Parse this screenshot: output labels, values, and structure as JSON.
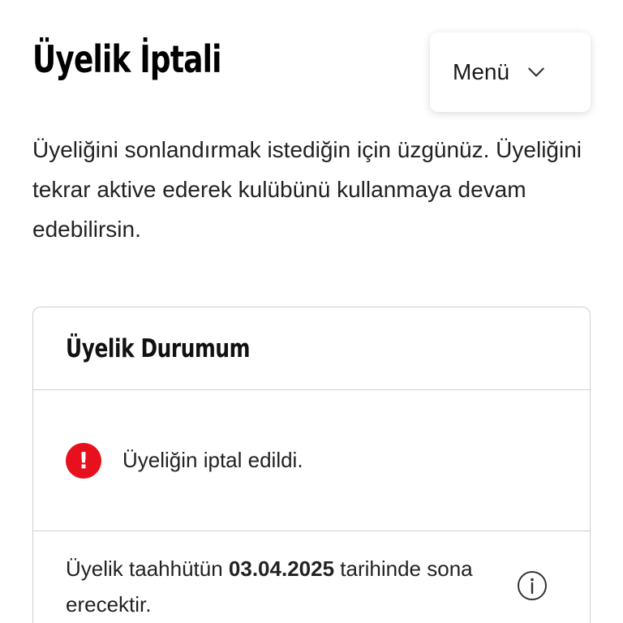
{
  "header": {
    "title": "Üyelik İptali",
    "menu_label": "Menü",
    "menu_icon": "chevron-down-icon"
  },
  "intro": {
    "text": "Üyeliğini sonlandırmak istediğin için üzgünüz. Üyeliğini tekrar aktive ederek kulübünü kullanmaya devam edebilirsin."
  },
  "membership_card": {
    "title": "Üyelik Durumum",
    "status": {
      "icon": "alert-icon",
      "icon_glyph": "!",
      "text": "Üyeliğin iptal edildi."
    },
    "commitment": {
      "prefix": "Üyelik taahhütün ",
      "date": "03.04.2025",
      "suffix": " tarihinde sona erecektir.",
      "info_icon": "info-icon"
    }
  },
  "colors": {
    "alert": "#e8101d",
    "border": "#cfcfcf",
    "text": "#1a1a1a"
  }
}
